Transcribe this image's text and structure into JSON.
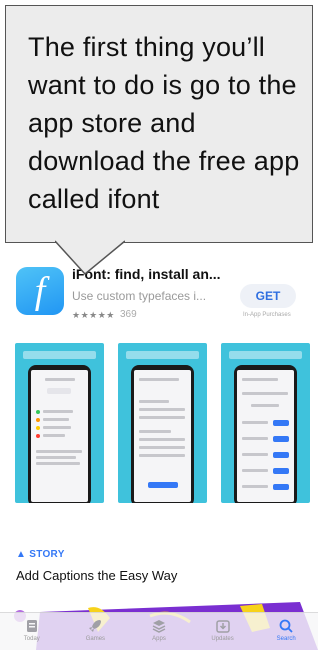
{
  "callout": {
    "text": "The first thing you’ll want to do is go to the app store and download the free app called ifont"
  },
  "app": {
    "icon_letter": "f",
    "title": "iFont: find, install an...",
    "subtitle": "Use custom typefaces i...",
    "stars": "★★★★★",
    "rating_count": "369",
    "get_label": "GET",
    "in_app_note": "In-App Purchases"
  },
  "story": {
    "tag": "▲ STORY",
    "title": "Add Captions the Easy Way"
  },
  "tabbar": {
    "tabs": [
      {
        "label": "Today",
        "icon": "today-icon"
      },
      {
        "label": "Games",
        "icon": "rocket-icon"
      },
      {
        "label": "Apps",
        "icon": "layers-icon"
      },
      {
        "label": "Updates",
        "icon": "download-tray-icon"
      },
      {
        "label": "Search",
        "icon": "search-icon",
        "active": true
      }
    ]
  },
  "colors": {
    "accent": "#3478f6",
    "screenshot_bg": "#3fc2dc",
    "story_purple": "#7a2fd1",
    "story_yellow": "#f7d21a"
  }
}
